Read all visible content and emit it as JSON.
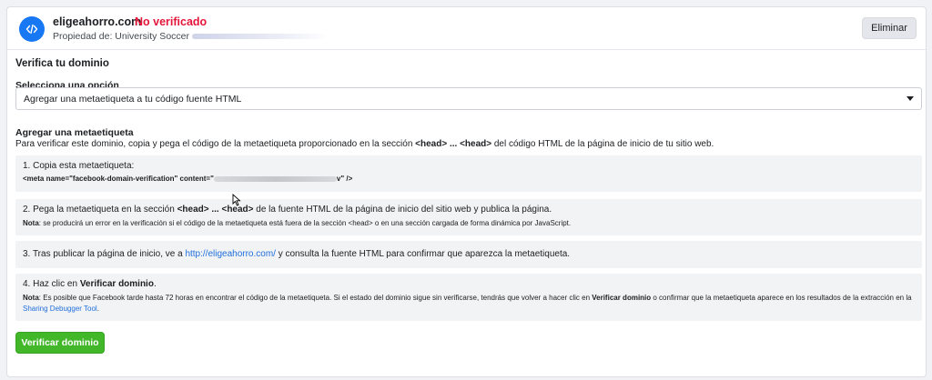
{
  "header": {
    "domain": "eligeahorro.com",
    "status": "No verificado",
    "owner_label": "Propiedad de: University Soccer",
    "delete_label": "Eliminar",
    "icon": "code-icon"
  },
  "verify_section": {
    "title": "Verifica tu dominio",
    "select_label": "Selecciona una opción",
    "select_value": "Agregar una metaetiqueta a tu código fuente HTML"
  },
  "meta_section": {
    "title": "Agregar una metaetiqueta",
    "desc_before": "Para verificar este dominio, copia y pega el código de la metaetiqueta proporcionado en la sección ",
    "desc_head_tags": "<head> ... <head>",
    "desc_after": " del código HTML de la página de inicio de tu sitio web."
  },
  "steps": {
    "step1": {
      "label": "1. Copia esta metaetiqueta:",
      "code_prefix": "<meta name=\"facebook-domain-verification\" content=\"",
      "code_suffix": "v\" />"
    },
    "step2": {
      "text_before": "2. Pega la metaetiqueta en la sección ",
      "text_bold": "<head> ... <head>",
      "text_after": " de la fuente HTML de la página de inicio del sitio web y publica la página.",
      "note_label": "Nota",
      "note_text": ": se producirá un error en la verificación si el código de la metaetiqueta está fuera de la sección <head> o en una sección cargada de forma dinámica por JavaScript."
    },
    "step3": {
      "text_before": "3. Tras publicar la página de inicio, ve a ",
      "link": "http://eligeahorro.com/",
      "text_after": " y consulta la fuente HTML para confirmar que aparezca la metaetiqueta."
    },
    "step4": {
      "text_before": "4. Haz clic en ",
      "text_bold": "Verificar dominio",
      "text_after": ".",
      "note_label": "Nota",
      "note_text_1": ": Es posible que Facebook tarde hasta 72 horas en encontrar el código de la metaetiqueta. Si el estado del dominio sigue sin verificarse, tendrás que volver a hacer clic en ",
      "note_bold": "Verificar dominio",
      "note_text_2": " o confirmar que la metaetiqueta aparece en los resultados de la extracción en la ",
      "note_link": "Sharing Debugger Tool",
      "note_text_3": "."
    }
  },
  "verify_button_label": "Verificar dominio",
  "colors": {
    "brand_blue": "#1877f2",
    "status_red": "#e4163a",
    "button_green": "#42b72a",
    "link_blue": "#216fdb"
  }
}
